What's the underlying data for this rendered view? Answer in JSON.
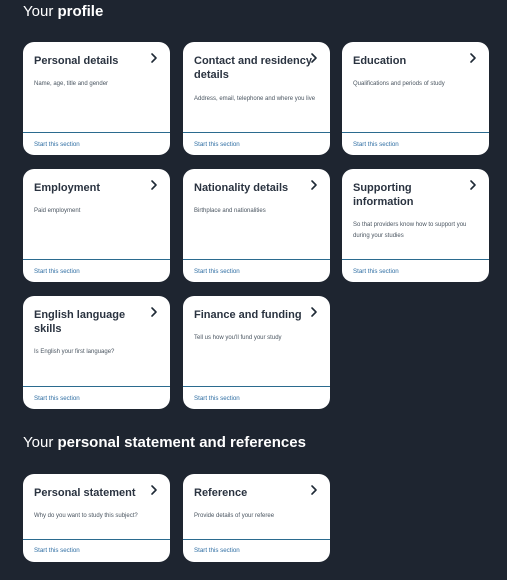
{
  "profile_heading": {
    "prefix": "Your",
    "bold": "profile"
  },
  "statement_heading": {
    "prefix": "Your",
    "bold": "personal statement and references"
  },
  "cards": [
    {
      "title": "Personal details",
      "description": "Name, age, title and gender",
      "link": "Start this section"
    },
    {
      "title": "Contact and residency details",
      "description": "Address, email, telephone and where you live",
      "link": "Start this section"
    },
    {
      "title": "Education",
      "description": "Qualifications and periods of study",
      "link": "Start this section"
    },
    {
      "title": "Employment",
      "description": "Paid employment",
      "link": "Start this section"
    },
    {
      "title": "Nationality details",
      "description": "Birthplace and nationalities",
      "link": "Start this section"
    },
    {
      "title": "Supporting information",
      "description": "So that providers know how to support you during your studies",
      "link": "Start this section"
    },
    {
      "title": "English language skills",
      "description": "Is English your first language?",
      "link": "Start this section"
    },
    {
      "title": "Finance and funding",
      "description": "Tell us how you'll fund your study",
      "link": "Start this section"
    },
    {
      "title": "Personal statement",
      "description": "Why do you want to study this subject?",
      "link": "Start this section"
    },
    {
      "title": "Reference",
      "description": "Provide details of your referee",
      "link": "Start this section"
    }
  ],
  "icons": {
    "arrow": "chevron-right-icon"
  }
}
